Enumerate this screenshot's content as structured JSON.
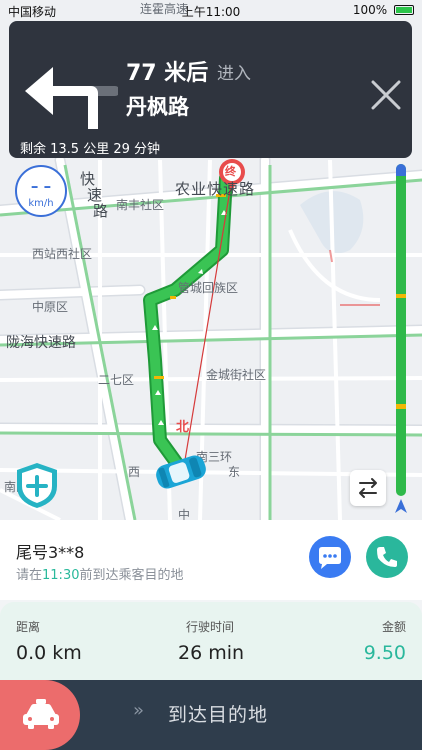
{
  "status_bar": {
    "carrier": "中国移动",
    "time": "上午11:00",
    "battery": "100%"
  },
  "navigation": {
    "distance": "77 米后",
    "action": "进入",
    "road": "丹枫路",
    "remaining": "剩余 13.5 公里 29 分钟",
    "turn_icon": "turn-left-icon"
  },
  "speed": {
    "value": "– –",
    "unit": "km/h"
  },
  "map": {
    "destination_marker": "终",
    "north_marker": "北",
    "labels": {
      "l1": "快",
      "l2": "速",
      "l3": "路",
      "road_nongye": "农业快速路",
      "nanfeng": "南丰社区",
      "xizhan": "西站西社区",
      "zhongyuan": "中原区",
      "longhai": "陇海快速路",
      "guancheng": "管城回族区",
      "erqi": "二七区",
      "jincheng": "金城街社区",
      "nansanhuan": "南三环",
      "xi": "西",
      "dong": "东",
      "nansi": "南四",
      "zhong": "中",
      "lianhe": "连霍高速"
    }
  },
  "trip": {
    "plate": "尾号3**8",
    "hint_prefix": "请在",
    "hint_time": "11:30",
    "hint_suffix": "前到达乘客目的地"
  },
  "stats": {
    "distance_label": "距离",
    "distance_value": "0.0 km",
    "duration_label": "行驶时间",
    "duration_value": "26 min",
    "amount_label": "金额",
    "amount_value": "9.50"
  },
  "bottom": {
    "arrows": "»",
    "arrive_label": "到达目的地"
  },
  "colors": {
    "route": "#2fb94a",
    "nav_card": "#2f343e",
    "accent": "#2ab79c",
    "chat": "#3a7bf2",
    "taxi": "#ec6c6c"
  }
}
